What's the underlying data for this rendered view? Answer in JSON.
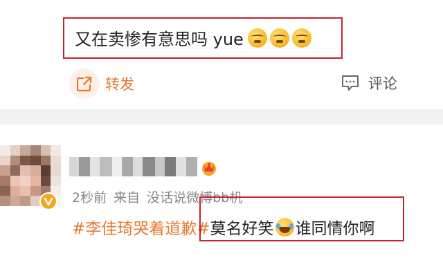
{
  "post": {
    "text": "又在卖惨有意思吗 yue",
    "emojis": [
      "yue-emoji",
      "yue-emoji",
      "yue-emoji"
    ]
  },
  "actions": {
    "share_label": "转发",
    "comment_label": "评论"
  },
  "comment": {
    "time": "2秒前",
    "source_prefix": "来自",
    "source": "没话说微博bb机",
    "hashtag": "#李佳琦哭着道歉#",
    "text_before_emoji": "莫名好笑",
    "emoji": "laugh-cry-emoji",
    "text_after_emoji": "谁同情你啊"
  },
  "colors": {
    "accent_orange": "#e8772e",
    "highlight_red": "#c8232c",
    "divider_gray": "#f2f2f2",
    "meta_gray": "#888888"
  }
}
